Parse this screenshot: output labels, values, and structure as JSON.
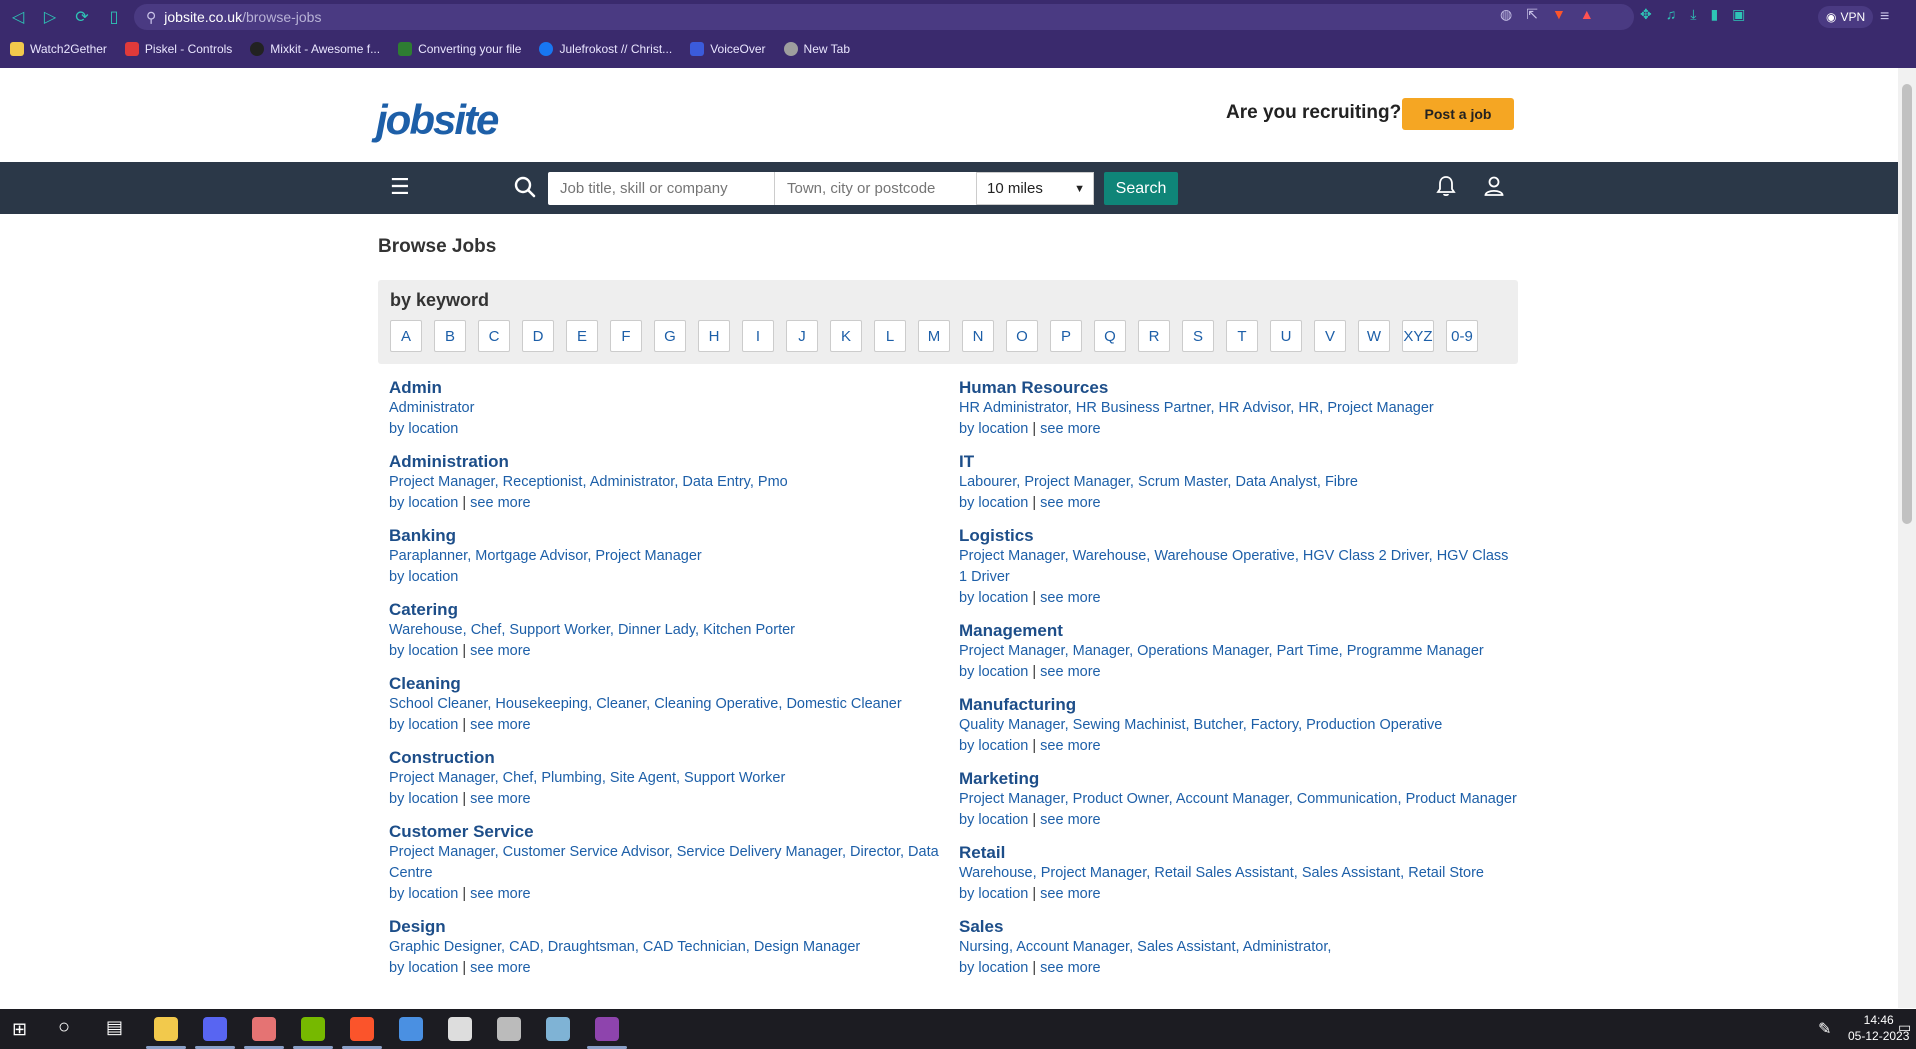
{
  "browser": {
    "url_host": "jobsite.co.uk",
    "url_path": "/browse-jobs",
    "vpn_label": "VPN",
    "bookmarks": [
      {
        "label": "Watch2Gether",
        "color": "#f2c94c"
      },
      {
        "label": "Piskel - Controls",
        "color": "#e03a3a"
      },
      {
        "label": "Mixkit - Awesome f...",
        "color": "#222222"
      },
      {
        "label": "Converting your file",
        "color": "#2e7d32"
      },
      {
        "label": "Julefrokost // Christ...",
        "color": "#1877f2"
      },
      {
        "label": "VoiceOver",
        "color": "#3b5bdb"
      },
      {
        "label": "New Tab",
        "color": "#9e9e9e"
      }
    ]
  },
  "header": {
    "logo": "jobsite",
    "recruit_text": "Are you recruiting?",
    "post_job_label": "Post a job"
  },
  "search": {
    "job_placeholder": "Job title, skill or company",
    "town_placeholder": "Town, city or postcode",
    "radius_value": "10 miles",
    "search_label": "Search"
  },
  "page": {
    "title": "Browse Jobs",
    "keyword_title": "by keyword",
    "letters": [
      "A",
      "B",
      "C",
      "D",
      "E",
      "F",
      "G",
      "H",
      "I",
      "J",
      "K",
      "L",
      "M",
      "N",
      "O",
      "P",
      "Q",
      "R",
      "S",
      "T",
      "U",
      "V",
      "W",
      "XYZ",
      "0-9"
    ],
    "by_location": "by location",
    "see_more": "see more"
  },
  "categories_left": [
    {
      "name": "Admin",
      "jobs": [
        "Administrator"
      ],
      "see_more": false
    },
    {
      "name": "Administration",
      "jobs": [
        "Project Manager",
        "Receptionist",
        "Administrator",
        "Data Entry",
        "Pmo"
      ],
      "see_more": true
    },
    {
      "name": "Banking",
      "jobs": [
        "Paraplanner",
        "Mortgage Advisor",
        "Project Manager"
      ],
      "see_more": false
    },
    {
      "name": "Catering",
      "jobs": [
        "Warehouse",
        "Chef",
        "Support Worker",
        "Dinner Lady",
        "Kitchen Porter"
      ],
      "see_more": true
    },
    {
      "name": "Cleaning",
      "jobs": [
        "School Cleaner",
        "Housekeeping",
        "Cleaner",
        "Cleaning Operative",
        "Domestic Cleaner"
      ],
      "see_more": true
    },
    {
      "name": "Construction",
      "jobs": [
        "Project Manager",
        "Chef",
        "Plumbing",
        "Site Agent",
        "Support Worker"
      ],
      "see_more": true
    },
    {
      "name": "Customer Service",
      "jobs": [
        "Project Manager",
        "Customer Service Advisor",
        "Service Delivery Manager",
        "Director",
        "Data Centre"
      ],
      "see_more": true
    },
    {
      "name": "Design",
      "jobs": [
        "Graphic Designer",
        "CAD",
        "Draughtsman",
        "CAD Technician",
        "Design Manager"
      ],
      "see_more": true
    }
  ],
  "categories_right": [
    {
      "name": "Human Resources",
      "jobs": [
        "HR Administrator",
        "HR Business Partner",
        "HR Advisor",
        "HR",
        "Project Manager"
      ],
      "see_more": true
    },
    {
      "name": "IT",
      "jobs": [
        "Labourer",
        "Project Manager",
        "Scrum Master",
        "Data Analyst",
        "Fibre"
      ],
      "see_more": true
    },
    {
      "name": "Logistics",
      "jobs": [
        "Project Manager",
        "Warehouse",
        "Warehouse Operative",
        "HGV Class 2 Driver",
        "HGV Class 1 Driver"
      ],
      "see_more": true
    },
    {
      "name": "Management",
      "jobs": [
        "Project Manager",
        "Manager",
        "Operations Manager",
        "Part Time",
        "Programme Manager"
      ],
      "see_more": true
    },
    {
      "name": "Manufacturing",
      "jobs": [
        "Quality Manager",
        "Sewing Machinist",
        "Butcher",
        "Factory",
        "Production Operative"
      ],
      "see_more": true
    },
    {
      "name": "Marketing",
      "jobs": [
        "Project Manager",
        "Product Owner",
        "Account Manager",
        "Communication",
        "Product Manager"
      ],
      "see_more": true
    },
    {
      "name": "Retail",
      "jobs": [
        "Warehouse",
        "Project Manager",
        "Retail Sales Assistant",
        "Sales Assistant",
        "Retail Store"
      ],
      "see_more": true
    },
    {
      "name": "Sales",
      "jobs": [
        "Nursing",
        "Account Manager",
        "Sales Assistant",
        "Administrator"
      ],
      "see_more": true,
      "trailing_comma": true
    }
  ],
  "taskbar": {
    "time": "14:46",
    "date": "05-12-2023",
    "apps": [
      {
        "name": "file-explorer",
        "color": "#f2c94c"
      },
      {
        "name": "discord",
        "color": "#5865f2"
      },
      {
        "name": "app-flower",
        "color": "#e57373"
      },
      {
        "name": "nvidia",
        "color": "#76b900"
      },
      {
        "name": "brave",
        "color": "#fb542b"
      },
      {
        "name": "app-editor",
        "color": "#4a90e2"
      },
      {
        "name": "unity",
        "color": "#dddddd"
      },
      {
        "name": "unity-hub",
        "color": "#bbbbbb"
      },
      {
        "name": "app-notes",
        "color": "#7fb3d5"
      },
      {
        "name": "github",
        "color": "#8e44ad"
      }
    ]
  }
}
